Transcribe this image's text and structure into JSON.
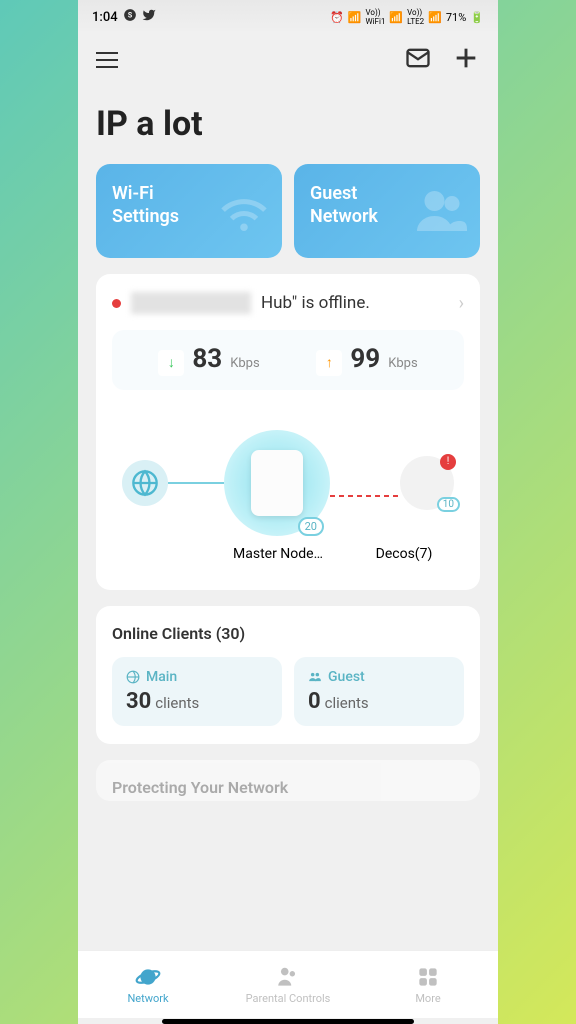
{
  "statusbar": {
    "time": "1:04",
    "battery": "71%"
  },
  "header": {
    "title": "IP a lot"
  },
  "tiles": {
    "wifi": "Wi-Fi\nSettings",
    "guest": "Guest\nNetwork"
  },
  "status": {
    "text": "Hub\" is offline."
  },
  "speed": {
    "down": "83",
    "down_unit": "Kbps",
    "up": "99",
    "up_unit": "Kbps"
  },
  "topology": {
    "master_badge": "20",
    "master_label": "Master Node…",
    "deco_badge": "10",
    "deco_alert": "!",
    "deco_label": "Decos(7)"
  },
  "clients": {
    "header": "Online Clients (30)",
    "main_label": "Main",
    "main_count": "30",
    "main_word": "clients",
    "guest_label": "Guest",
    "guest_count": "0",
    "guest_word": "clients"
  },
  "protect": {
    "title": "Protecting Your Network"
  },
  "nav": {
    "network": "Network",
    "parental": "Parental Controls",
    "more": "More"
  }
}
